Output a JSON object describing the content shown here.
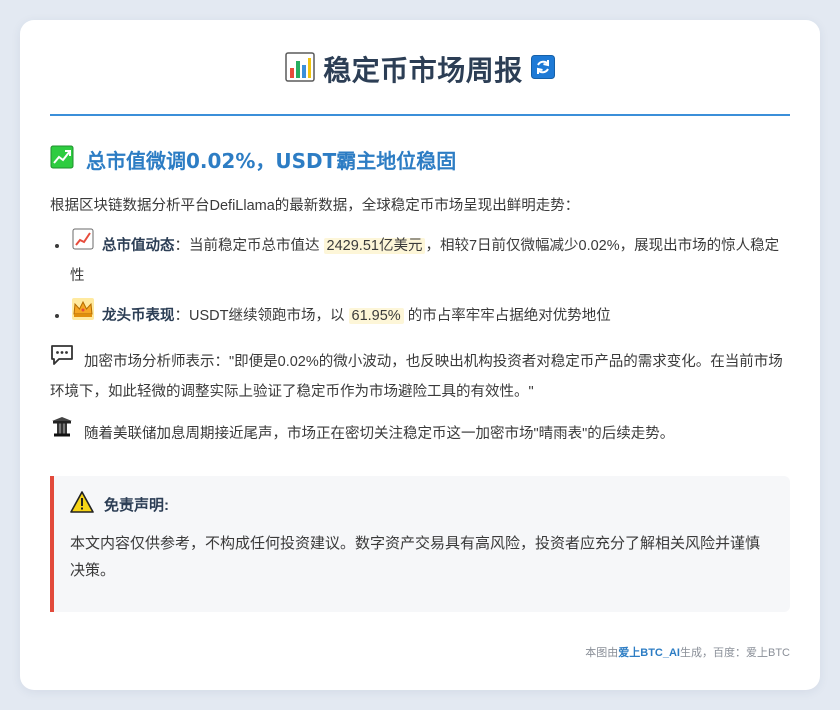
{
  "header": {
    "title": "稳定币市场周报",
    "title_icon": "bar-chart-icon",
    "refresh_icon": "refresh-icon"
  },
  "headline": {
    "icon": "chart-up-icon",
    "text": "总市值微调0.02%，USDT霸主地位稳固"
  },
  "intro": "根据区块链数据分析平台DefiLlama的最新数据，全球稳定币市场呈现出鲜明走势：",
  "bullets": [
    {
      "icon": "chart-increasing-icon",
      "label": "总市值动态",
      "text_before": "：当前稳定币总市值达 ",
      "highlight": "2429.51亿美元",
      "text_after": "，相较7日前仅微幅减少0.02%，展现出市场的惊人稳定性"
    },
    {
      "icon": "crown-icon",
      "label": "龙头币表现",
      "text_before": "：USDT继续领跑市场，以 ",
      "highlight": "61.95%",
      "text_after": " 的市占率牢牢占据绝对优势地位"
    }
  ],
  "quote": {
    "icon": "speech-bubble-icon",
    "text": "加密市场分析师表示：\"即便是0.02%的微小波动，也反映出机构投资者对稳定币产品的需求变化。在当前市场环境下，如此轻微的调整实际上验证了稳定币作为市场避险工具的有效性。\""
  },
  "fed": {
    "icon": "pillar-icon",
    "text": "随着美联储加息周期接近尾声，市场正在密切关注稳定币这一加密市场\"晴雨表\"的后续走势。"
  },
  "disclaimer": {
    "icon": "warning-icon",
    "title": "免责声明:",
    "body": "本文内容仅供参考，不构成任何投资建议。数字资产交易具有高风险，投资者应充分了解相关风险并谨慎决策。"
  },
  "footer": {
    "prefix": "本图由",
    "brand": "爱上BTC_AI",
    "suffix": "生成，百度：爱上BTC"
  },
  "colors": {
    "accent": "#2d7dc4",
    "rule": "#3b8fd9",
    "disclaimer_border": "#e24a3b",
    "highlight_bg": "#fdf6d8"
  }
}
